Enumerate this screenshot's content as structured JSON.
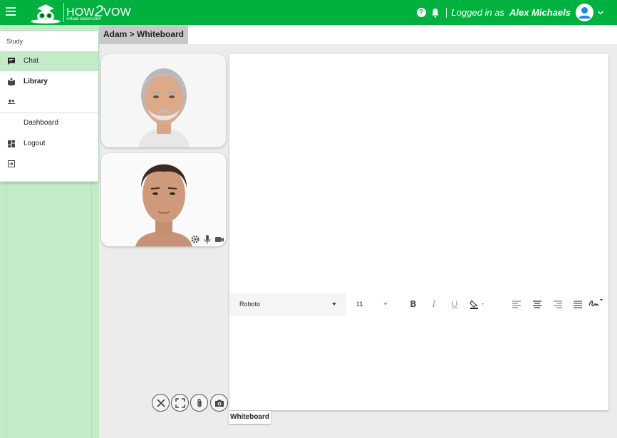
{
  "header": {
    "logo_main": "HOW",
    "logo_two": "2",
    "logo_end": "VOW",
    "logo_sub": "virtual classroom",
    "logged_prefix": "Logged in as",
    "user_name": "Alex Michaels",
    "accent": "#00b140"
  },
  "sidebar": {
    "title": "Study",
    "items": [
      {
        "label": "Chat",
        "icon": "chat-icon",
        "active": true
      },
      {
        "label": "Library",
        "icon": "library-icon"
      },
      {
        "label": "",
        "icon": "people-icon"
      },
      {
        "label": "Dashboard",
        "icon": ""
      },
      {
        "label": "Logout",
        "icon": "dashboard-icon"
      },
      {
        "label": "",
        "icon": "logout-icon"
      }
    ]
  },
  "breadcrumb": "Adam > Whiteboard",
  "editor": {
    "font": "Roboto",
    "size": "11",
    "tools": [
      "bold",
      "italic",
      "underline",
      "fill-color",
      "align-left",
      "align-center",
      "align-right",
      "justify",
      "signature"
    ]
  },
  "tab_label": "Whiteboard",
  "call_controls": [
    "close-icon",
    "fullscreen-icon",
    "attach-icon",
    "camera-icon"
  ]
}
